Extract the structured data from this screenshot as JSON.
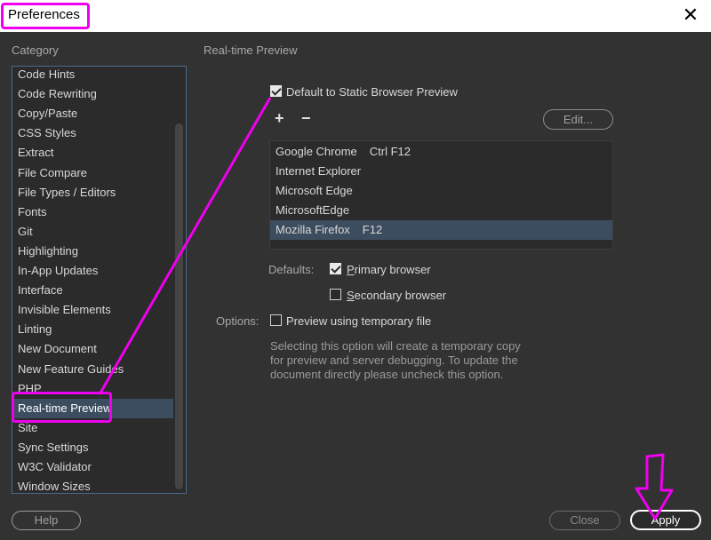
{
  "window": {
    "title": "Preferences"
  },
  "sidebar": {
    "label": "Category",
    "items": [
      "Code Hints",
      "Code Rewriting",
      "Copy/Paste",
      "CSS Styles",
      "Extract",
      "File Compare",
      "File Types / Editors",
      "Fonts",
      "Git",
      "Highlighting",
      "In-App Updates",
      "Interface",
      "Invisible Elements",
      "Linting",
      "New Document",
      "New Feature Guides",
      "PHP",
      "Real-time Preview",
      "Site",
      "Sync Settings",
      "W3C Validator",
      "Window Sizes"
    ],
    "selected": "Real-time Preview"
  },
  "panel": {
    "title": "Real-time Preview",
    "default_static_label": "Default to Static Browser Preview",
    "default_static_checked": true,
    "add_icon": "+",
    "remove_icon": "−",
    "edit_label": "Edit...",
    "browsers": [
      {
        "name": "Google Chrome",
        "key": "Ctrl F12"
      },
      {
        "name": "Internet Explorer",
        "key": ""
      },
      {
        "name": "Microsoft Edge",
        "key": ""
      },
      {
        "name": "MicrosoftEdge",
        "key": ""
      },
      {
        "name": "Mozilla Firefox",
        "key": "F12"
      }
    ],
    "selected_browser": "Mozilla Firefox",
    "defaults_label": "Defaults:",
    "primary_label": "Primary browser",
    "primary_checked": true,
    "secondary_label": "Secondary browser",
    "secondary_checked": false,
    "options_label": "Options:",
    "temp_file_label": "Preview using temporary file",
    "temp_file_checked": false,
    "description": "Selecting this option will create a temporary copy for preview and server debugging. To update the document directly please uncheck this option."
  },
  "footer": {
    "help_label": "Help",
    "close_label": "Close",
    "apply_label": "Apply"
  },
  "colors": {
    "highlight": "#ee00ee",
    "selection": "#3d4d60"
  }
}
